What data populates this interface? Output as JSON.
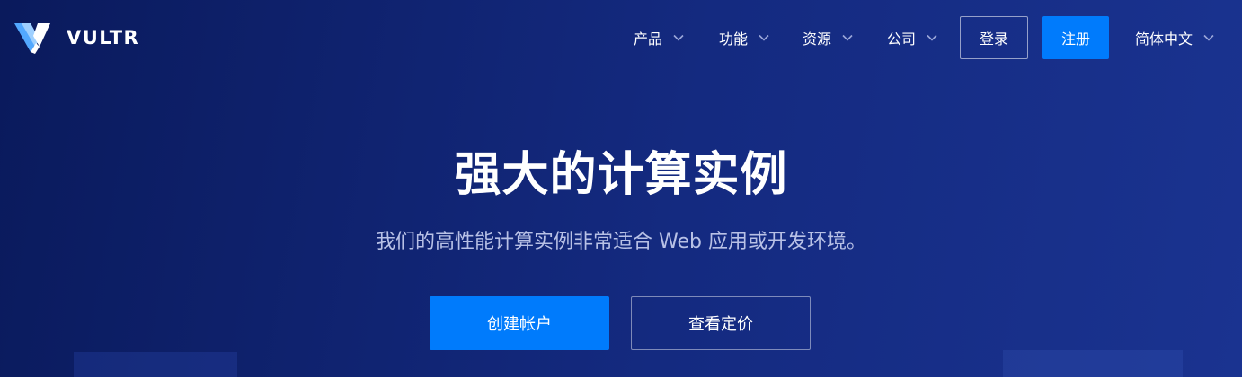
{
  "brand": {
    "name": "VULTR",
    "logo_icon": "vultr-logo-icon",
    "accent_color": "#007bfc"
  },
  "nav": {
    "items": [
      {
        "label": "产品",
        "icon": "chevron-down-icon"
      },
      {
        "label": "功能",
        "icon": "chevron-down-icon"
      },
      {
        "label": "资源",
        "icon": "chevron-down-icon"
      },
      {
        "label": "公司",
        "icon": "chevron-down-icon"
      }
    ],
    "login_label": "登录",
    "signup_label": "注册",
    "language": {
      "label": "简体中文",
      "icon": "chevron-down-icon"
    }
  },
  "hero": {
    "title": "强大的计算实例",
    "subtitle": "我们的高性能计算实例非常适合 Web 应用或开发环境。",
    "primary_cta": "创建帐户",
    "secondary_cta": "查看定价"
  }
}
